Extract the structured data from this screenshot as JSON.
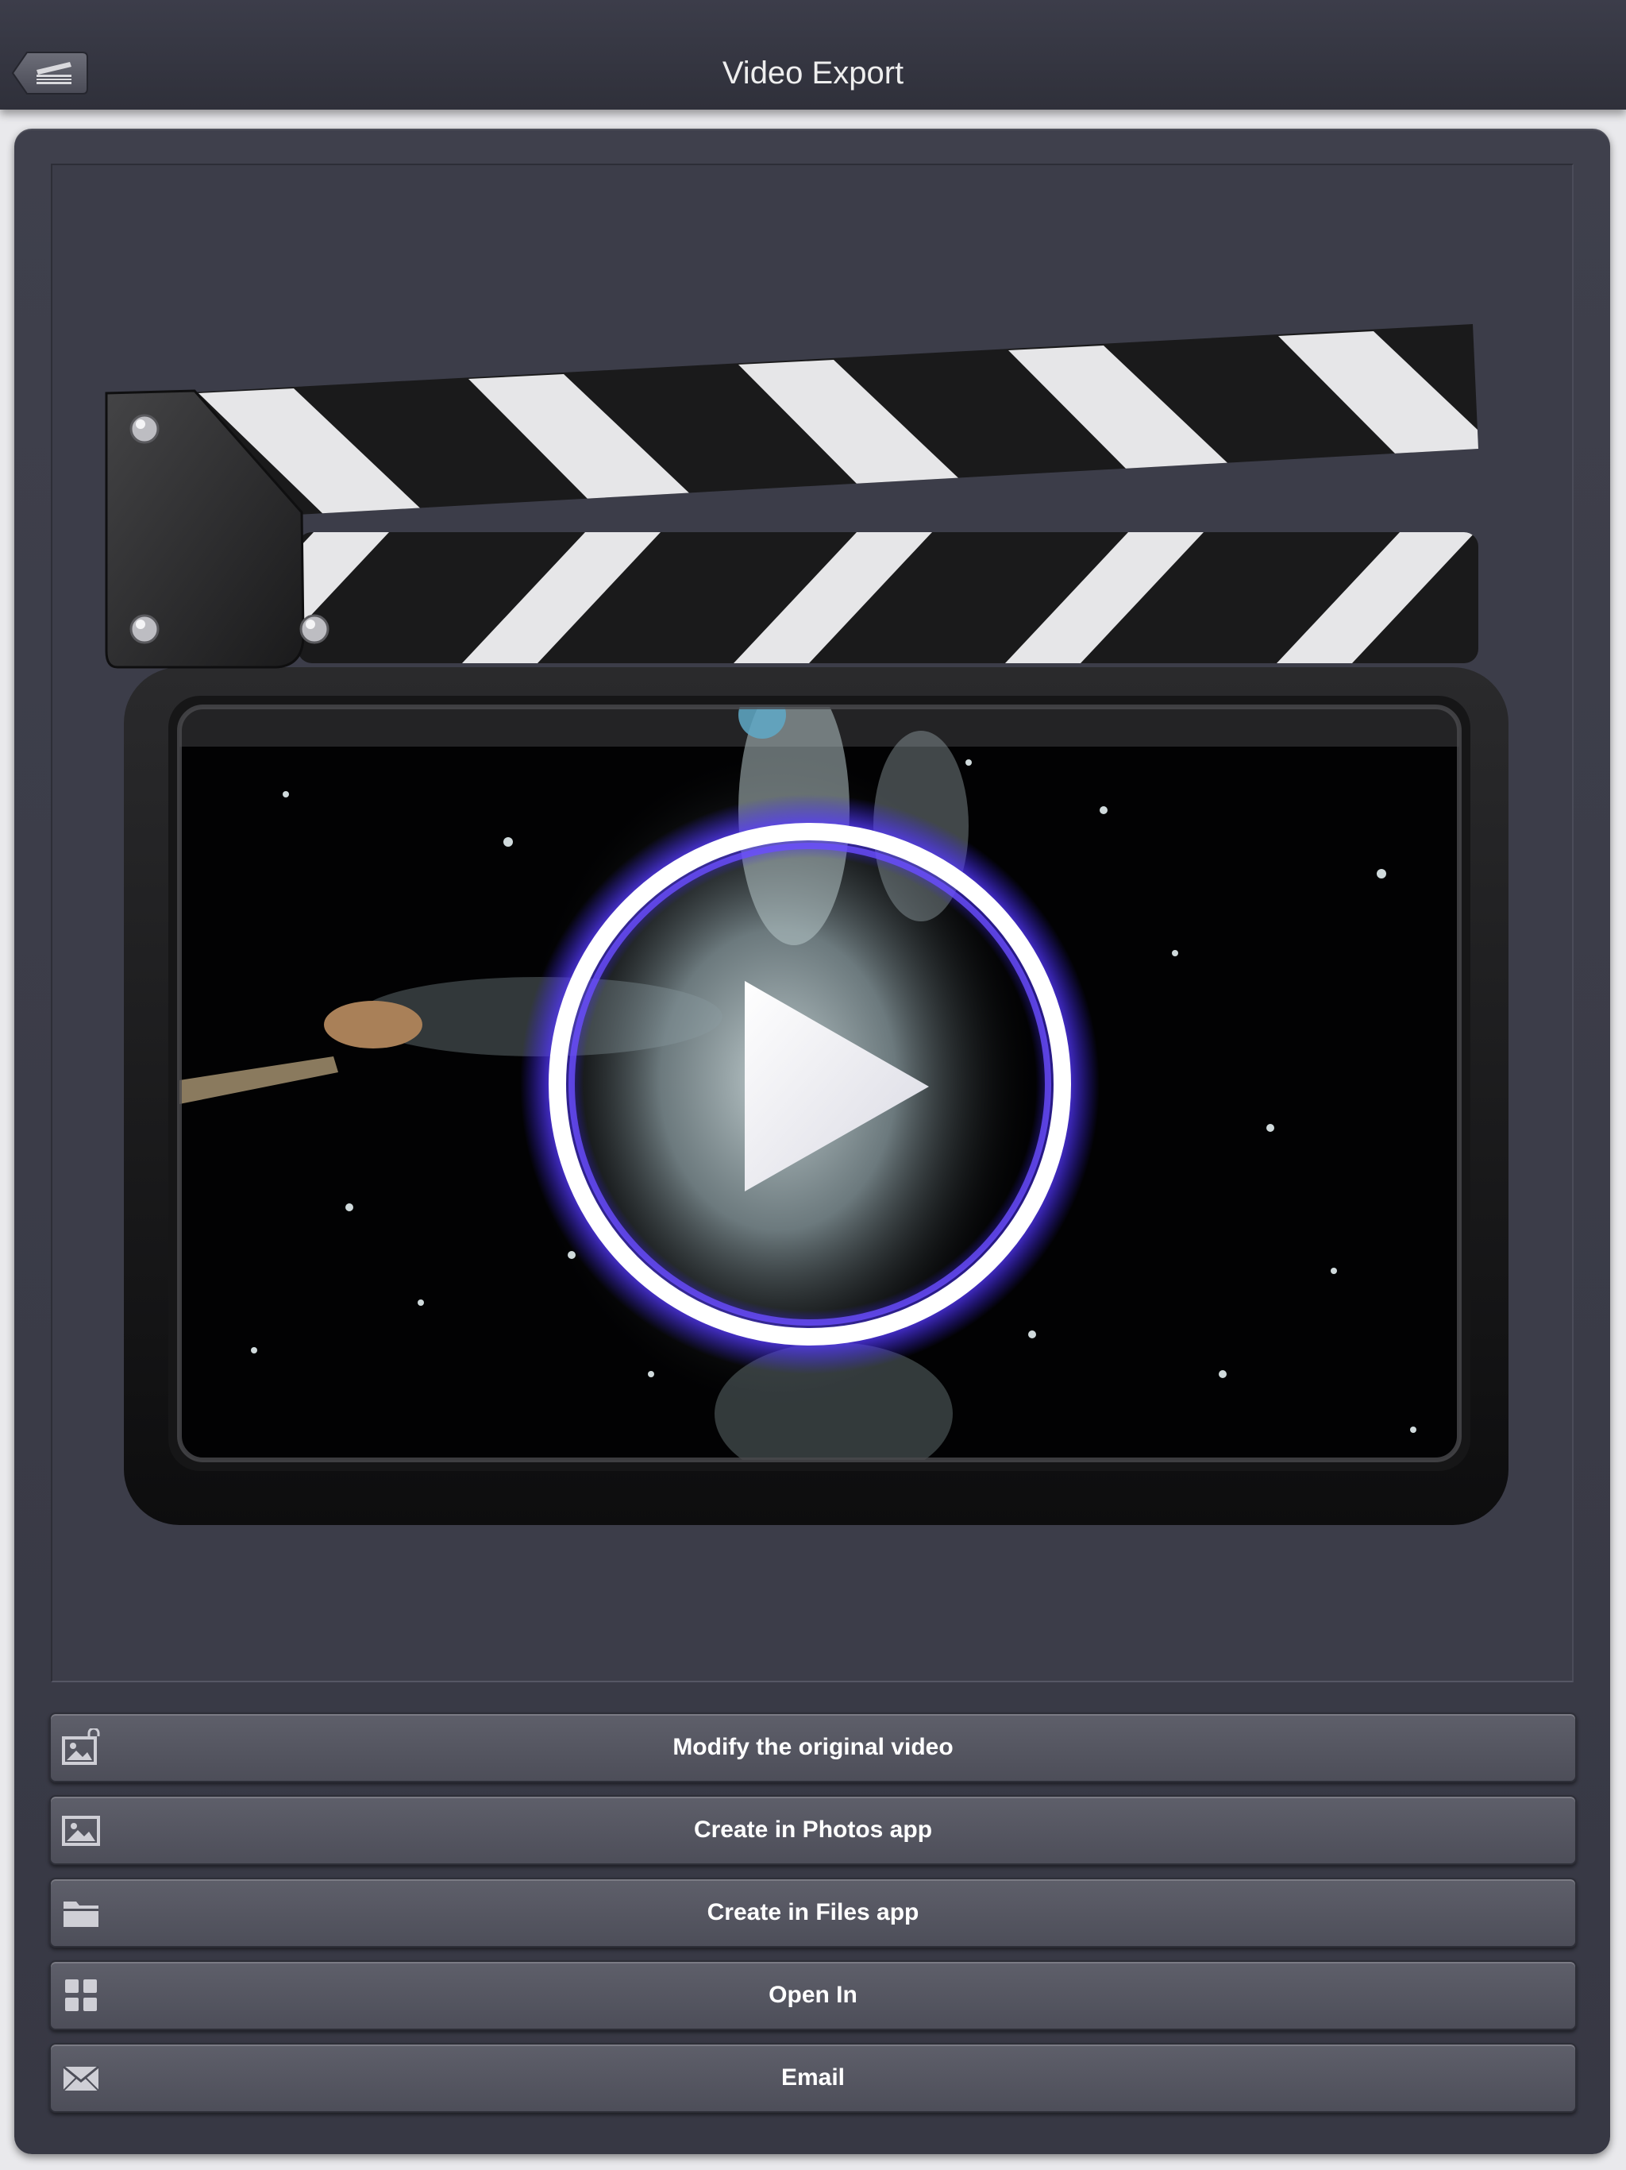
{
  "navbar": {
    "title": "Video Export",
    "back_icon": "clapperboard-back-icon"
  },
  "preview": {
    "graphic": "clapperboard-icon",
    "thumbnail": "water-splash-video-frame",
    "overlay_icon": "play-icon"
  },
  "actions": [
    {
      "label": "Modify the original video",
      "icon": "photo-lock-icon"
    },
    {
      "label": "Create in Photos app",
      "icon": "photo-icon"
    },
    {
      "label": "Create in Files app",
      "icon": "folder-icon"
    },
    {
      "label": "Open In",
      "icon": "grid-icon"
    },
    {
      "label": "Email",
      "icon": "envelope-icon"
    }
  ],
  "colors": {
    "navbar": "#33343f",
    "panel": "#3c3d49",
    "button": "#565762",
    "play_glow": "#5a3cff"
  }
}
